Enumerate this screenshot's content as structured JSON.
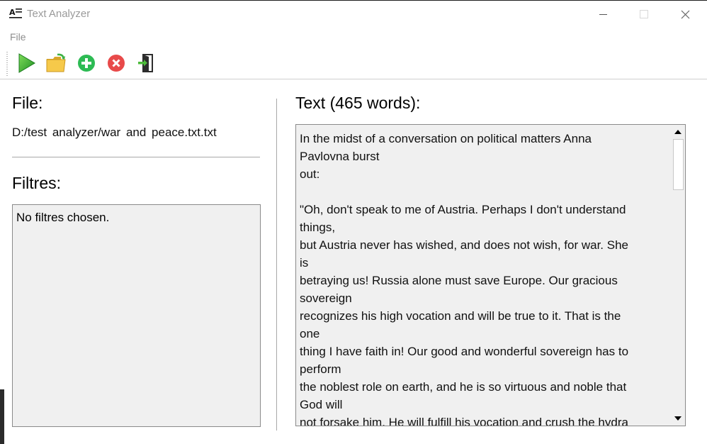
{
  "window": {
    "title": "Text Analyzer",
    "menu": {
      "file_label": "File"
    }
  },
  "toolbar": {
    "buttons": [
      {
        "name": "run-button",
        "icon": "play-icon",
        "color": "#2fa12f"
      },
      {
        "name": "open-folder-button",
        "icon": "open-folder-icon",
        "color": "#f2c53d"
      },
      {
        "name": "add-filter-button",
        "icon": "plus-circle-icon",
        "color": "#2dbb54"
      },
      {
        "name": "remove-filter-button",
        "icon": "x-circle-icon",
        "color": "#e84a4a"
      },
      {
        "name": "exit-button",
        "icon": "exit-door-icon",
        "color": "#2d2d2d"
      }
    ]
  },
  "left_panel": {
    "file_heading": "File:",
    "file_path": "D:/test analyzer/war and peace.txt.txt",
    "filters_heading": "Filtres:",
    "filters_text": "No filtres chosen."
  },
  "right_panel": {
    "text_heading": "Text (465 words):",
    "lines": [
      "In the midst of a conversation on political matters Anna",
      "Pavlovna burst",
      "out:",
      "",
      "\"Oh, don't speak to me of Austria. Perhaps I don't understand",
      "things,",
      "but Austria never has wished, and does not wish, for war. She",
      "is",
      "betraying us! Russia alone must save Europe. Our gracious",
      "sovereign",
      "recognizes his high vocation and will be true to it. That is the",
      "one",
      "thing I have faith in! Our good and wonderful sovereign has to",
      "perform",
      "the noblest role on earth, and he is so virtuous and noble that",
      "God will",
      "not forsake him. He will fulfill his vocation and crush the hydra"
    ]
  }
}
